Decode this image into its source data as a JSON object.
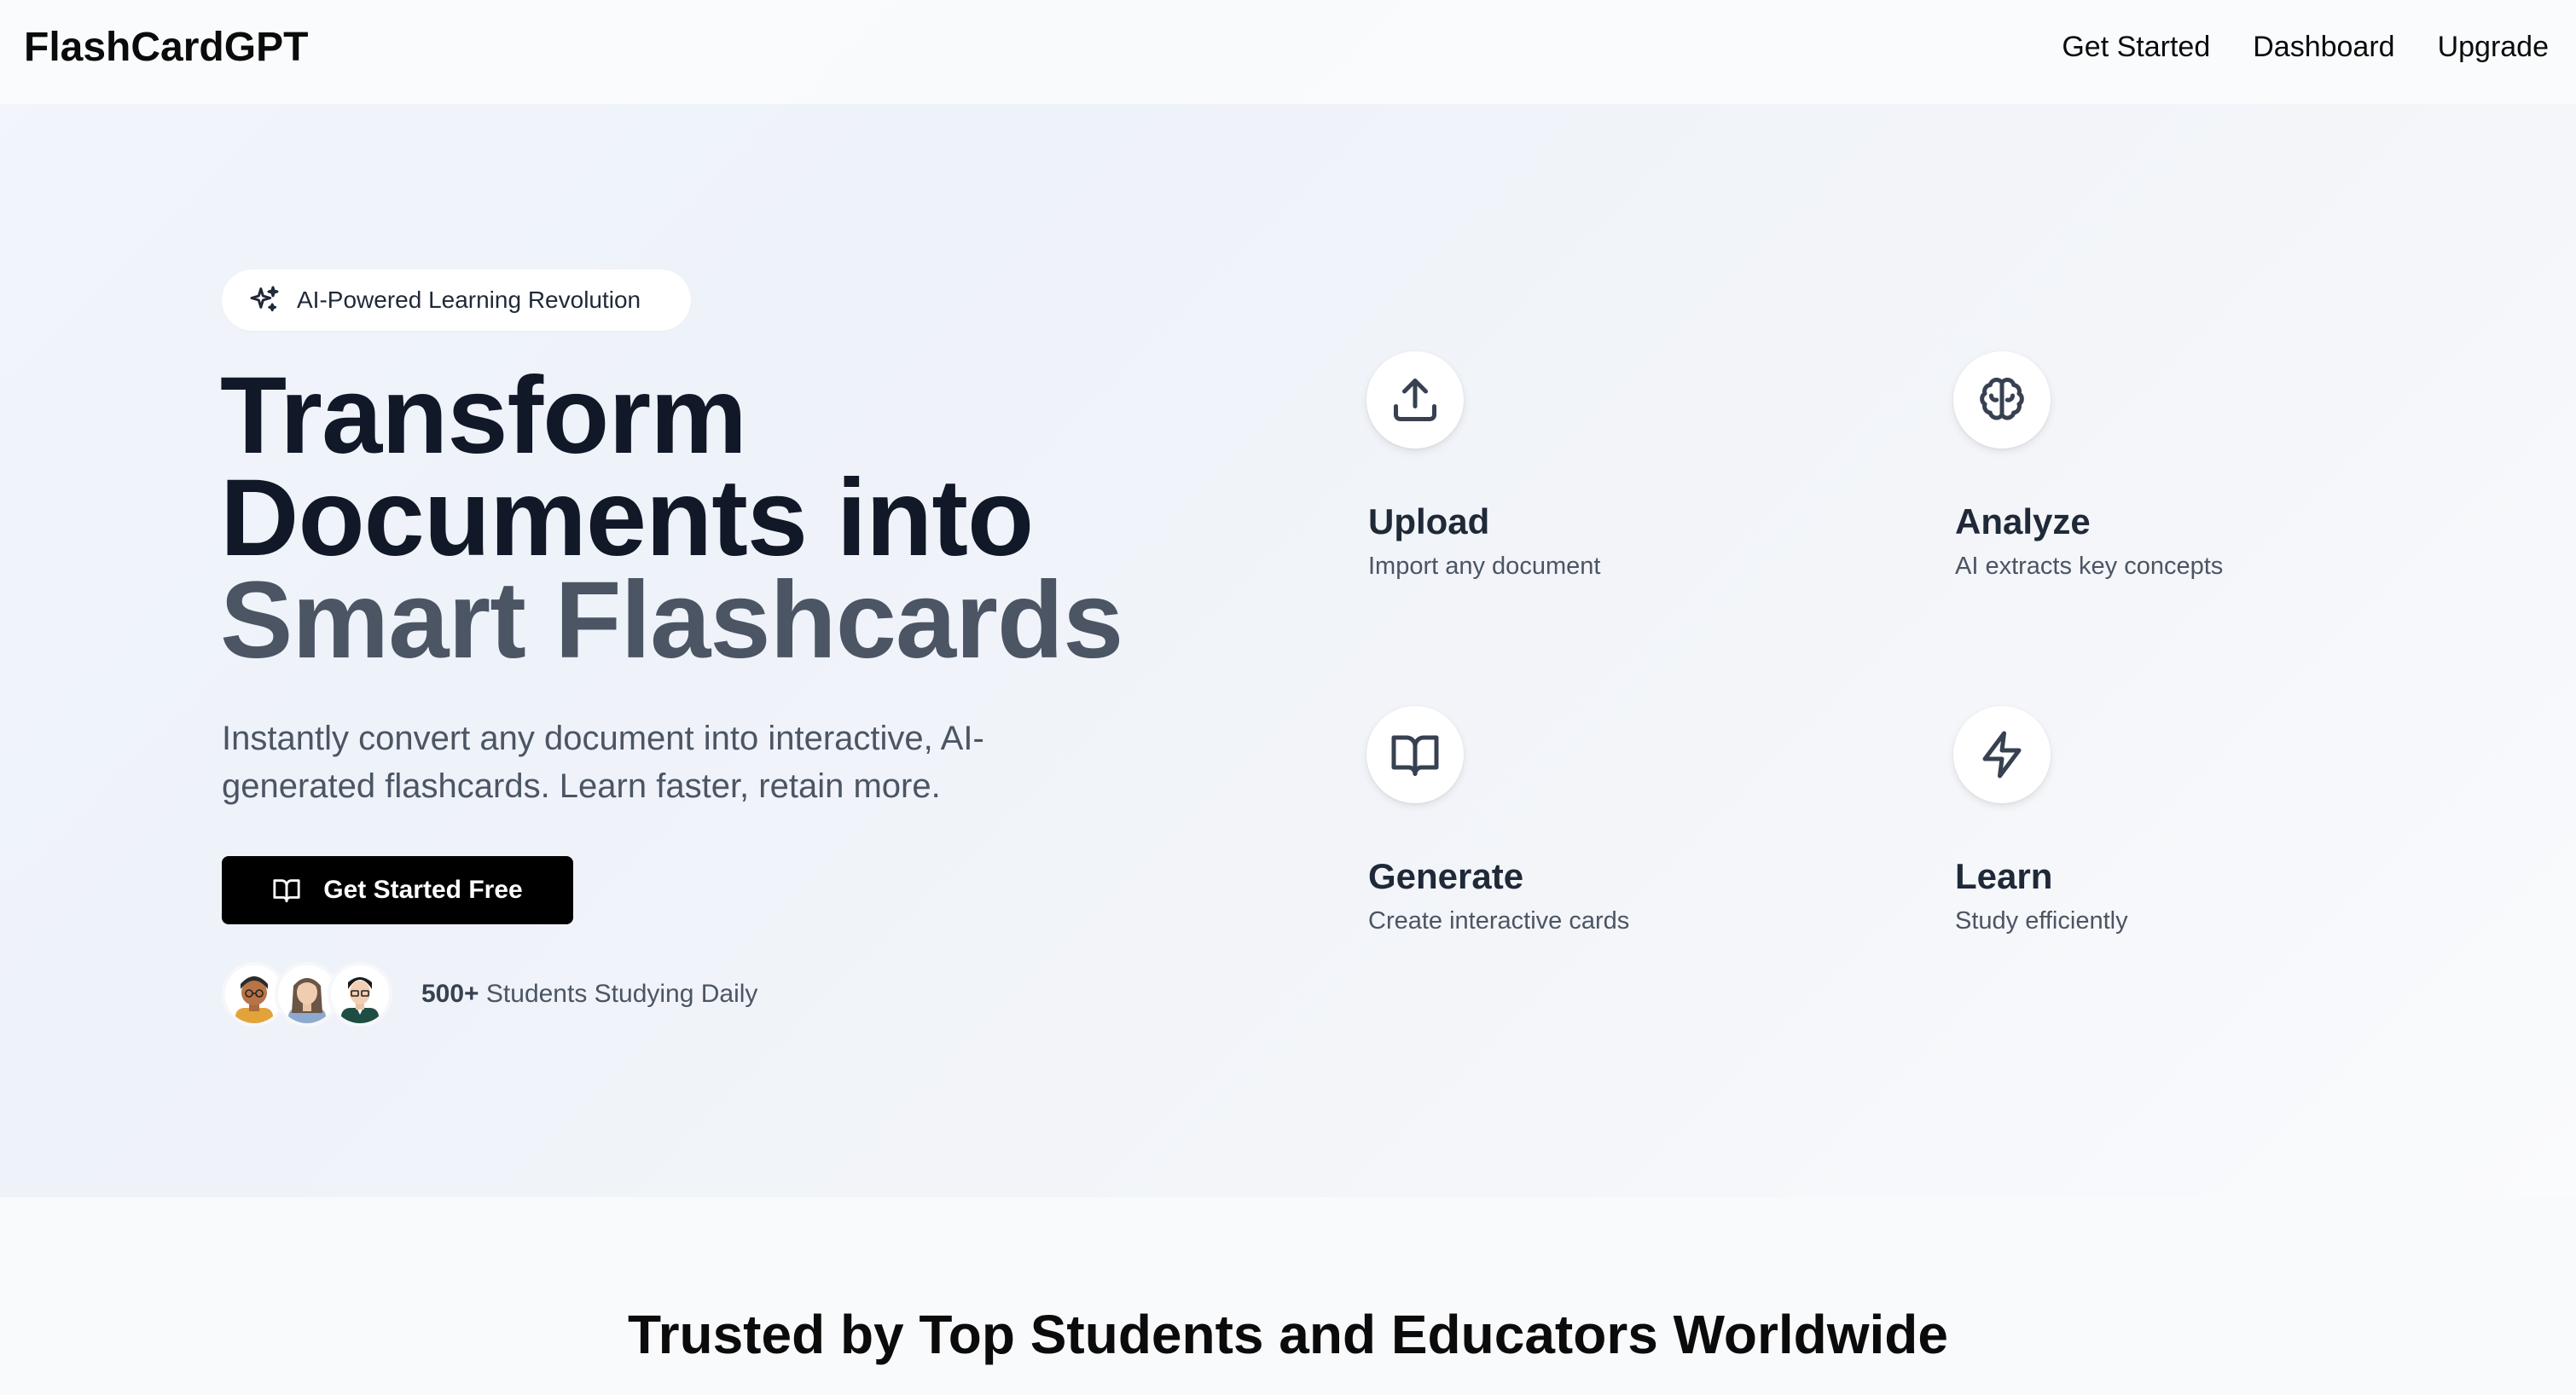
{
  "header": {
    "logo": "FlashCardGPT",
    "nav": [
      "Get Started",
      "Dashboard",
      "Upgrade"
    ]
  },
  "hero": {
    "badge": "AI-Powered Learning Revolution",
    "headline": [
      "Transform",
      "Documents into",
      "Smart Flashcards"
    ],
    "subtext": "Instantly convert any document into interactive, AI-generated flashcards. Learn faster, retain more.",
    "cta_label": "Get Started Free",
    "social_count": "500+",
    "social_label": " Students Studying Daily"
  },
  "features": [
    {
      "title": "Upload",
      "description": "Import any document",
      "icon": "upload-icon"
    },
    {
      "title": "Analyze",
      "description": "AI extracts key concepts",
      "icon": "brain-icon"
    },
    {
      "title": "Generate",
      "description": "Create interactive cards",
      "icon": "book-open-icon"
    },
    {
      "title": "Learn",
      "description": "Study efficiently",
      "icon": "lightning-icon"
    }
  ],
  "trusted_heading": "Trusted by Top Students and Educators Worldwide",
  "colors": {
    "primary_text": "#111827",
    "accent_text": "#4b5563",
    "cta_bg": "#000000"
  }
}
